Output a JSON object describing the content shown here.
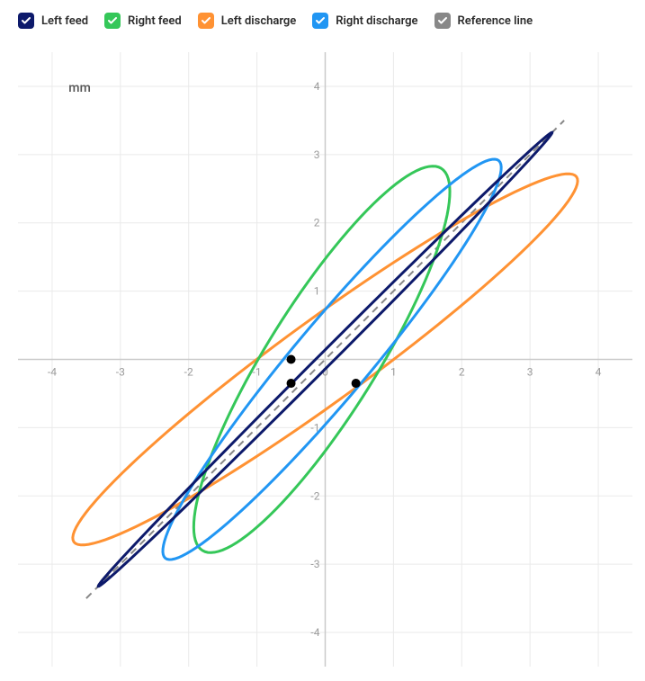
{
  "legend": {
    "items": [
      {
        "key": "left_feed",
        "label": "Left feed",
        "color": "#0d1a6b",
        "checked": true
      },
      {
        "key": "right_feed",
        "label": "Right feed",
        "color": "#35c759",
        "checked": true
      },
      {
        "key": "left_discharge",
        "label": "Left discharge",
        "color": "#ff9233",
        "checked": true
      },
      {
        "key": "right_discharge",
        "label": "Right discharge",
        "color": "#2196f3",
        "checked": true
      },
      {
        "key": "reference",
        "label": "Reference line",
        "color": "#888888",
        "checked": true
      }
    ]
  },
  "unit_label": "mm",
  "chart_data": {
    "type": "scatter",
    "xlim": [
      -4.5,
      4.5
    ],
    "ylim": [
      -4.5,
      4.5
    ],
    "xticks": [
      -4,
      -3,
      -2,
      -1,
      0,
      1,
      2,
      3,
      4
    ],
    "yticks": [
      -4,
      -3,
      -2,
      -1,
      0,
      1,
      2,
      3,
      4
    ],
    "grid": true,
    "unit": "mm",
    "reference_line": {
      "start": [
        -3.5,
        -3.5
      ],
      "end": [
        3.5,
        3.5
      ],
      "style": "dashed",
      "color": "#888888"
    },
    "markers": [
      {
        "x": -0.5,
        "y": 0.0,
        "color": "#000000"
      },
      {
        "x": -0.5,
        "y": -0.35,
        "color": "#000000"
      },
      {
        "x": 0.45,
        "y": -0.35,
        "color": "#000000"
      }
    ],
    "series": [
      {
        "name": "Left feed",
        "color": "#0d1a6b",
        "shape": "ellipse",
        "center": [
          0.0,
          0.0
        ],
        "semi_major": 4.7,
        "semi_minor": 0.1,
        "angle_deg": 45
      },
      {
        "name": "Right feed",
        "color": "#35c759",
        "shape": "ellipse",
        "center": [
          -0.05,
          0.0
        ],
        "semi_major": 3.3,
        "semi_minor": 0.8,
        "angle_deg": 58
      },
      {
        "name": "Left discharge",
        "color": "#ff9233",
        "shape": "ellipse",
        "center": [
          0.0,
          0.0
        ],
        "semi_major": 4.55,
        "semi_minor": 0.6,
        "angle_deg": 36
      },
      {
        "name": "Right discharge",
        "color": "#2196f3",
        "shape": "ellipse",
        "center": [
          0.1,
          0.0
        ],
        "semi_major": 3.8,
        "semi_minor": 0.55,
        "angle_deg": 50
      }
    ]
  }
}
